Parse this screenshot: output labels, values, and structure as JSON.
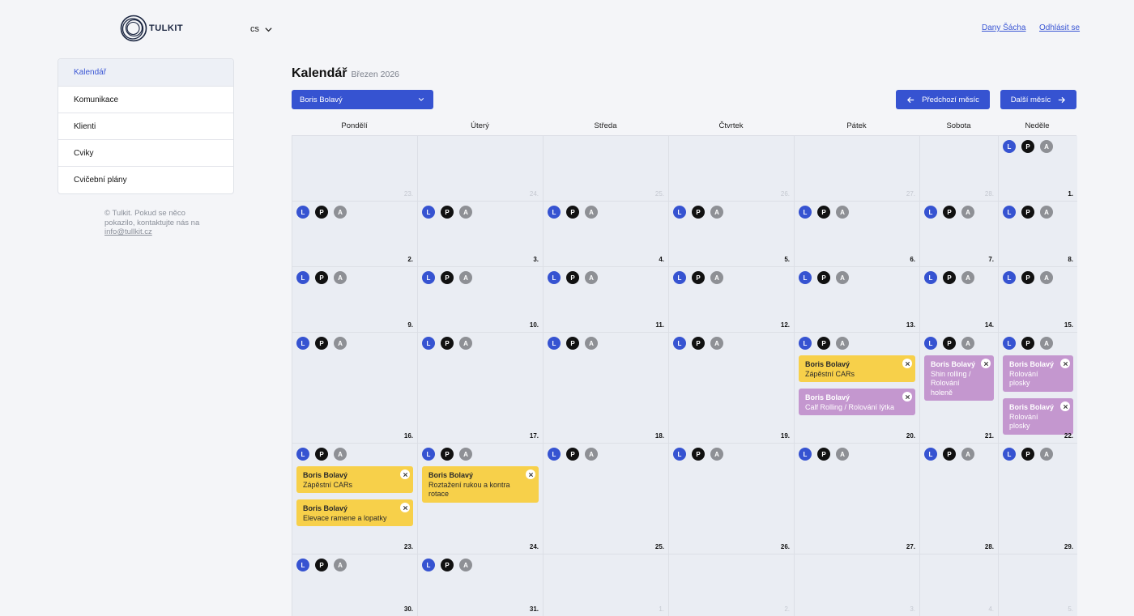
{
  "header": {
    "brand": "TULKIT",
    "lang": "cs",
    "user_link": "Dany Šácha",
    "logout_link": "Odhlásit se"
  },
  "sidebar": {
    "items": [
      {
        "label": "Kalendář",
        "active": true
      },
      {
        "label": "Komunikace",
        "active": false
      },
      {
        "label": "Klienti",
        "active": false
      },
      {
        "label": "Cviky",
        "active": false
      },
      {
        "label": "Cvičební plány",
        "active": false
      }
    ],
    "footer_text": "© Tulkit. Pokud se něco pokazilo, kontaktujte nás na",
    "footer_email": "info@tullkit.cz"
  },
  "main": {
    "title": "Kalendář",
    "subtitle": "Březen 2026",
    "client_select": "Boris Bolavý",
    "prev_month": "Předchozí měsíc",
    "next_month": "Další měsíc",
    "weekdays": [
      "Pondělí",
      "Úterý",
      "Středa",
      "Čtvrtek",
      "Pátek",
      "Sobota",
      "Neděle"
    ],
    "badge_labels": [
      "L",
      "P",
      "A"
    ],
    "colors": {
      "accent": "#3653d1",
      "event_yellow": "#f7d04a",
      "event_purple": "#c497cf"
    },
    "weeks": [
      [
        {
          "day": "23.",
          "other": true,
          "badges": false,
          "events": []
        },
        {
          "day": "24.",
          "other": true,
          "badges": false,
          "events": []
        },
        {
          "day": "25.",
          "other": true,
          "badges": false,
          "events": []
        },
        {
          "day": "26.",
          "other": true,
          "badges": false,
          "events": []
        },
        {
          "day": "27.",
          "other": true,
          "badges": false,
          "events": []
        },
        {
          "day": "28.",
          "other": true,
          "badges": false,
          "events": []
        },
        {
          "day": "1.",
          "other": false,
          "badges": true,
          "events": []
        }
      ],
      [
        {
          "day": "2.",
          "other": false,
          "badges": true,
          "events": []
        },
        {
          "day": "3.",
          "other": false,
          "badges": true,
          "events": []
        },
        {
          "day": "4.",
          "other": false,
          "badges": true,
          "events": []
        },
        {
          "day": "5.",
          "other": false,
          "badges": true,
          "events": []
        },
        {
          "day": "6.",
          "other": false,
          "badges": true,
          "events": []
        },
        {
          "day": "7.",
          "other": false,
          "badges": true,
          "events": []
        },
        {
          "day": "8.",
          "other": false,
          "badges": true,
          "events": []
        }
      ],
      [
        {
          "day": "9.",
          "other": false,
          "badges": true,
          "events": []
        },
        {
          "day": "10.",
          "other": false,
          "badges": true,
          "events": []
        },
        {
          "day": "11.",
          "other": false,
          "badges": true,
          "events": []
        },
        {
          "day": "12.",
          "other": false,
          "badges": true,
          "events": []
        },
        {
          "day": "13.",
          "other": false,
          "badges": true,
          "events": []
        },
        {
          "day": "14.",
          "other": false,
          "badges": true,
          "events": []
        },
        {
          "day": "15.",
          "other": false,
          "badges": true,
          "events": []
        }
      ],
      [
        {
          "day": "16.",
          "other": false,
          "badges": true,
          "events": []
        },
        {
          "day": "17.",
          "other": false,
          "badges": true,
          "events": []
        },
        {
          "day": "18.",
          "other": false,
          "badges": true,
          "events": []
        },
        {
          "day": "19.",
          "other": false,
          "badges": true,
          "events": []
        },
        {
          "day": "20.",
          "other": false,
          "badges": true,
          "events": [
            {
              "title": "Boris Bolavý",
              "text": "Zápěstní CARs",
              "color": "yellow"
            },
            {
              "title": "Boris Bolavý",
              "text": "Calf Rolling / Rolování lýtka",
              "color": "purple"
            }
          ]
        },
        {
          "day": "21.",
          "other": false,
          "badges": true,
          "events": [
            {
              "title": "Boris Bolavý",
              "text": "Shin rolling / Rolování holeně",
              "color": "purple"
            }
          ]
        },
        {
          "day": "22.",
          "other": false,
          "badges": true,
          "events": [
            {
              "title": "Boris Bolavý",
              "text": "Rolování plosky",
              "color": "purple"
            },
            {
              "title": "Boris Bolavý",
              "text": "Rolování plosky",
              "color": "purple"
            }
          ]
        }
      ],
      [
        {
          "day": "23.",
          "other": false,
          "badges": true,
          "events": [
            {
              "title": "Boris Bolavý",
              "text": "Zápěstní CARs",
              "color": "yellow"
            },
            {
              "title": "Boris Bolavý",
              "text": "Elevace ramene a lopatky",
              "color": "yellow"
            }
          ]
        },
        {
          "day": "24.",
          "other": false,
          "badges": true,
          "events": [
            {
              "title": "Boris Bolavý",
              "text": "Roztažení rukou a kontra rotace",
              "color": "yellow"
            }
          ]
        },
        {
          "day": "25.",
          "other": false,
          "badges": true,
          "events": []
        },
        {
          "day": "26.",
          "other": false,
          "badges": true,
          "events": []
        },
        {
          "day": "27.",
          "other": false,
          "badges": true,
          "events": []
        },
        {
          "day": "28.",
          "other": false,
          "badges": true,
          "events": []
        },
        {
          "day": "29.",
          "other": false,
          "badges": true,
          "events": []
        }
      ],
      [
        {
          "day": "30.",
          "other": false,
          "badges": true,
          "events": []
        },
        {
          "day": "31.",
          "other": false,
          "badges": true,
          "events": []
        },
        {
          "day": "1.",
          "other": true,
          "badges": false,
          "events": []
        },
        {
          "day": "2.",
          "other": true,
          "badges": false,
          "events": []
        },
        {
          "day": "3.",
          "other": true,
          "badges": false,
          "events": []
        },
        {
          "day": "4.",
          "other": true,
          "badges": false,
          "events": []
        },
        {
          "day": "5.",
          "other": true,
          "badges": false,
          "events": []
        }
      ]
    ]
  }
}
